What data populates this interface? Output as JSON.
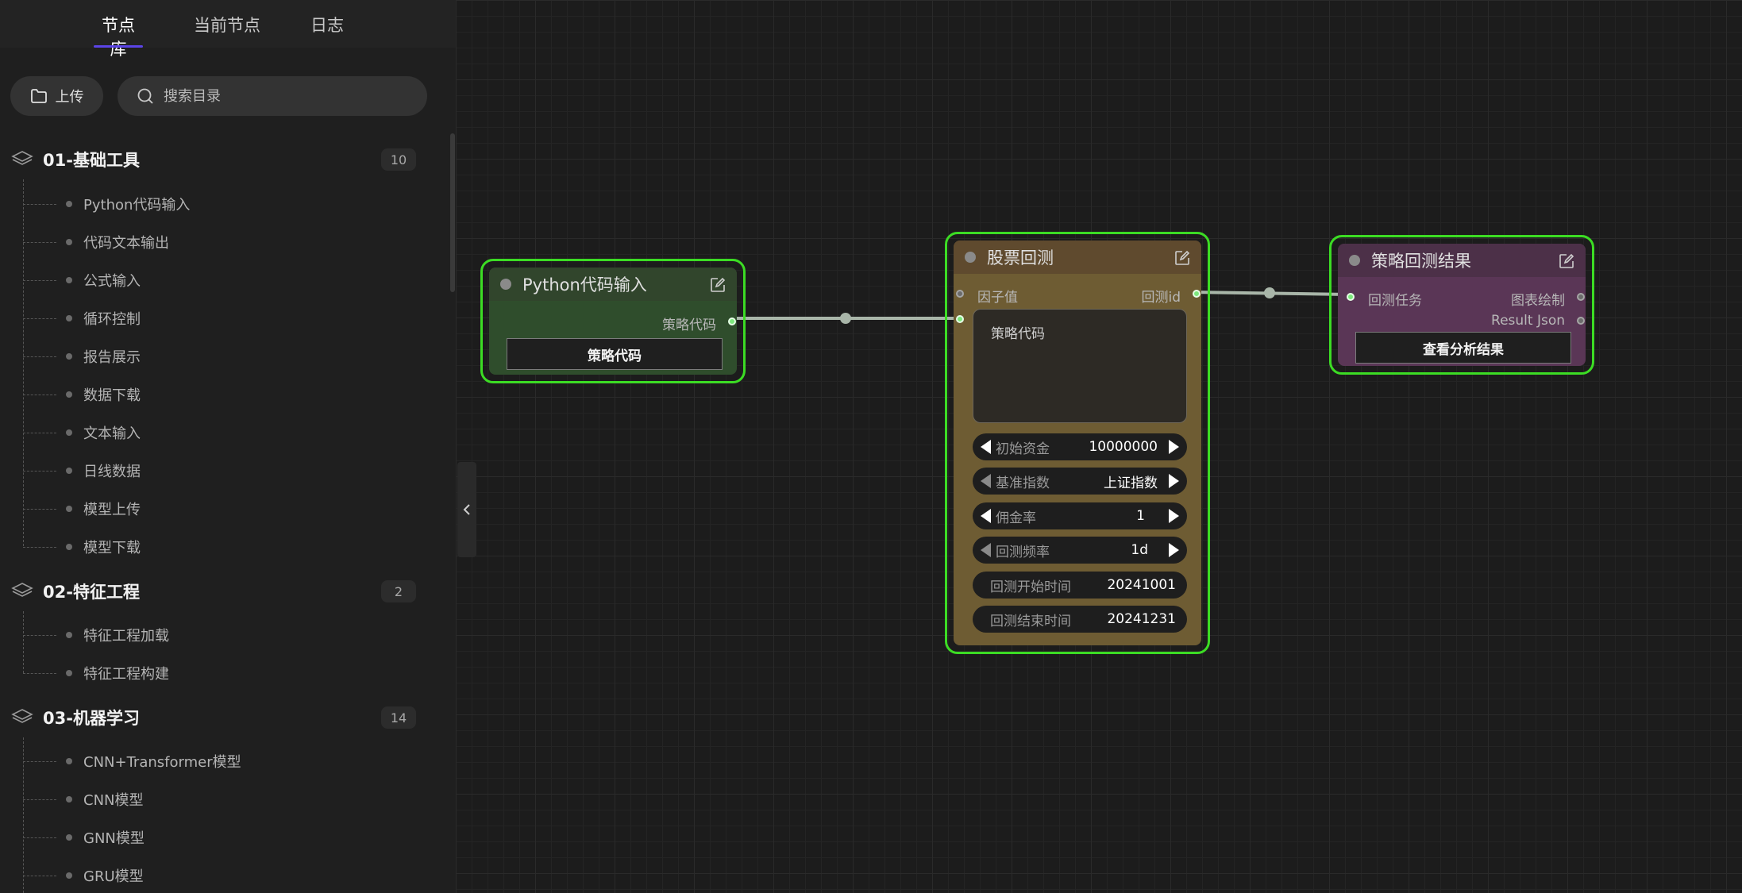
{
  "tabs": [
    {
      "label": "节点库"
    },
    {
      "label": "当前节点"
    },
    {
      "label": "日志"
    }
  ],
  "toolbar": {
    "upload_label": "上传"
  },
  "search": {
    "placeholder": "搜索目录"
  },
  "categories": [
    {
      "title": "01-基础工具",
      "count": "10",
      "items": [
        "Python代码输入",
        "代码文本输出",
        "公式输入",
        "循环控制",
        "报告展示",
        "数据下载",
        "文本输入",
        "日线数据",
        "模型上传",
        "模型下载"
      ]
    },
    {
      "title": "02-特征工程",
      "count": "2",
      "items": [
        "特征工程加载",
        "特征工程构建"
      ]
    },
    {
      "title": "03-机器学习",
      "count": "14",
      "items": [
        "CNN+Transformer模型",
        "CNN模型",
        "GNN模型",
        "GRU模型"
      ]
    }
  ],
  "nodes": {
    "python_input": {
      "title": "Python代码输入",
      "output_label": "策略代码",
      "button_label": "策略代码",
      "color": "#2f4d2c"
    },
    "backtest": {
      "title": "股票回测",
      "input_factor": "因子值",
      "output_id": "回测id",
      "code_placeholder": "策略代码",
      "color": "#6e5c33",
      "widgets": [
        {
          "label": "初始资金",
          "value": "10000000"
        },
        {
          "label": "基准指数",
          "value": "上证指数"
        },
        {
          "label": "佣金率",
          "value": "1"
        },
        {
          "label": "回测频率",
          "value": "1d"
        },
        {
          "label": "回测开始时间",
          "value": "20241001"
        },
        {
          "label": "回测结束时间",
          "value": "20241231"
        }
      ]
    },
    "result": {
      "title": "策略回测结果",
      "input_task": "回测任务",
      "output_chart": "图表绘制",
      "output_json": "Result Json",
      "button_label": "查看分析结果",
      "color": "#5a3656"
    }
  },
  "colors": {
    "selected_border": "#3cdc24",
    "accent": "#5b44e6"
  }
}
